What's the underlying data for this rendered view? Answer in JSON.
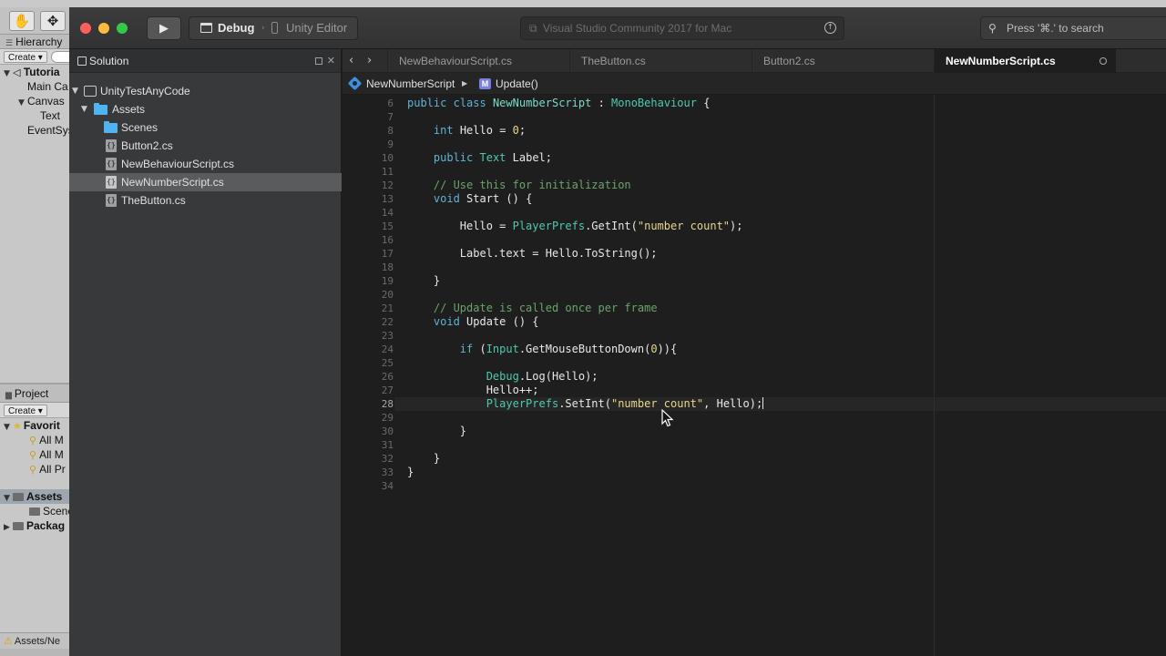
{
  "unity": {
    "hierarchy_tab": "Hierarchy",
    "create_label": "Create",
    "hierarchy_items": [
      "Tutoria",
      "Main Ca",
      "Canvas",
      "Text",
      "EventSys"
    ],
    "project_tab": "Project",
    "favorites_label": "Favorit",
    "favorite_items": [
      "All M",
      "All M",
      "All Pr"
    ],
    "assets_label": "Assets",
    "scenes_label": "Scene",
    "packages_label": "Packag",
    "status_path": "Assets/Ne"
  },
  "titlebar": {
    "config_name": "Debug",
    "config_target": "Unity Editor",
    "status_text": "Visual Studio Community 2017 for Mac",
    "search_placeholder": "Press '⌘.' to search"
  },
  "solution": {
    "pad_title": "Solution",
    "solution_name": "UnityTestAnyCode",
    "assets_folder": "Assets",
    "scenes_folder": "Scenes",
    "files": [
      "Button2.cs",
      "NewBehaviourScript.cs",
      "NewNumberScript.cs",
      "TheButton.cs"
    ],
    "selected_file": "NewNumberScript.cs"
  },
  "editor": {
    "tabs": [
      "NewBehaviourScript.cs",
      "TheButton.cs",
      "Button2.cs",
      "NewNumberScript.cs"
    ],
    "active_tab": "NewNumberScript.cs",
    "path_class": "NewNumberScript",
    "path_member": "Update()",
    "line_numbers": [
      "6",
      "7",
      "8",
      "9",
      "10",
      "11",
      "12",
      "13",
      "14",
      "15",
      "16",
      "17",
      "18",
      "19",
      "20",
      "21",
      "22",
      "23",
      "24",
      "25",
      "26",
      "27",
      "28",
      "29",
      "30",
      "31",
      "32",
      "33",
      "34"
    ],
    "current_line": "28"
  },
  "code": {
    "l6": [
      "public",
      "class",
      "NewNumberScript",
      ":",
      "MonoBehaviour",
      "{"
    ],
    "l8": [
      "int",
      "Hello",
      "=",
      "0",
      ";"
    ],
    "l10": [
      "public",
      "Text",
      "Label;"
    ],
    "l12": "// Use this for initialization",
    "l13": [
      "void",
      "Start () {"
    ],
    "l15": [
      "Hello = ",
      "PlayerPrefs",
      ".GetInt(",
      "\"number count\"",
      ");"
    ],
    "l17": "Label.text = Hello.ToString();",
    "l19": "}",
    "l21": "// Update is called once per frame",
    "l22": [
      "void",
      "Update () {"
    ],
    "l24": [
      "if",
      " (",
      "Input",
      ".GetMouseButtonDown(",
      "0",
      ")){"
    ],
    "l26": [
      "Debug",
      ".Log(Hello);"
    ],
    "l27": "Hello++;",
    "l28": [
      "PlayerPrefs",
      ".SetInt(",
      "\"number count\"",
      ", Hello);"
    ],
    "l30": "}",
    "l32": "}",
    "l33": "}"
  },
  "icons": {
    "hand_tool": "hand-icon",
    "move_tool": "move-icon",
    "play": "play-icon",
    "search": "search-icon"
  },
  "colors": {
    "keyword": "#5fb3d4",
    "type": "#4ec9b0",
    "string": "#e8d68a",
    "comment": "#6aa36a",
    "folder": "#4fb4f0"
  }
}
